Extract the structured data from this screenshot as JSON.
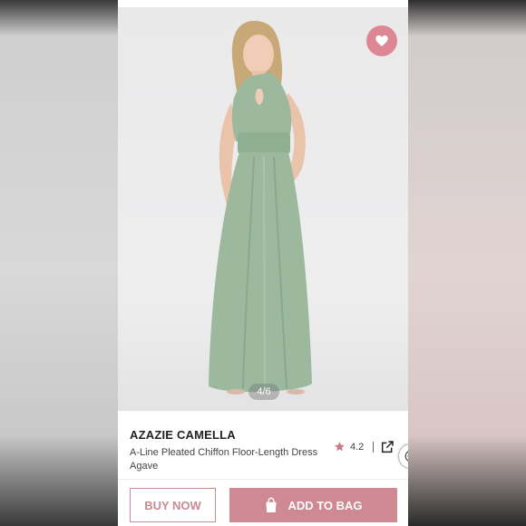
{
  "product": {
    "brand": "AZAZIE CAMELLA",
    "name": "A-Line Pleated Chiffon Floor-Length Dress Agave",
    "rating": "4.2",
    "dress_color": "#9cb99e"
  },
  "gallery": {
    "page_indicator": "4/6",
    "current": 4,
    "total": 6
  },
  "actions": {
    "buy_now": "BUY NOW",
    "add_to_bag": "ADD TO BAG"
  },
  "icons": {
    "wishlist": "heart-icon",
    "rating": "star-icon",
    "share": "share-external-icon",
    "more": "more-dots-icon",
    "bag": "shopping-bag-icon"
  },
  "colors": {
    "accent": "#cf8993",
    "wishlist_bg": "#dd8795"
  }
}
